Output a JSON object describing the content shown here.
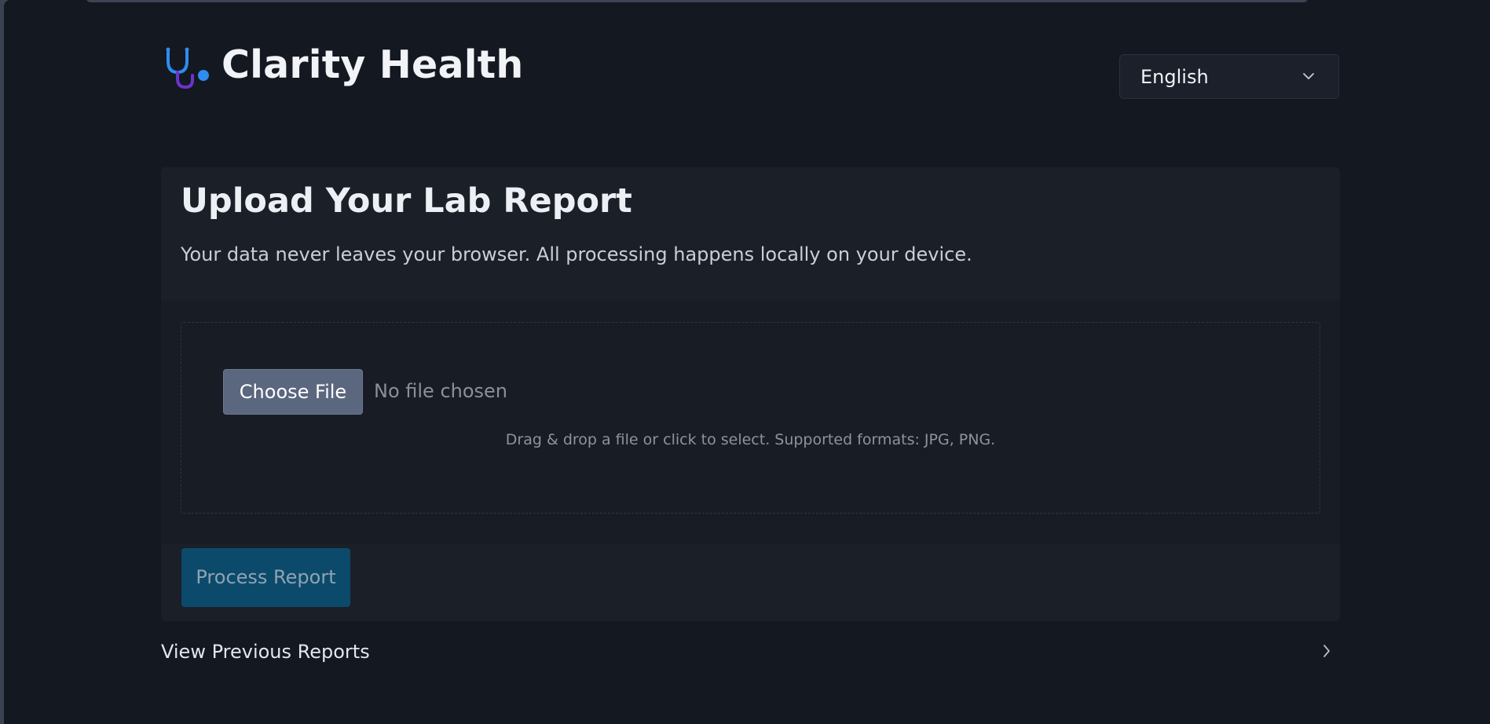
{
  "app": {
    "title": "Clarity Health",
    "logo_icon": "stethoscope-icon",
    "colors": {
      "background": "#131821",
      "card": "#1b1f28",
      "process_button": "#0c4a6b",
      "choose_button": "#5b667f",
      "logo_blue": "#2f8cf0",
      "logo_purple": "#6b34c9"
    }
  },
  "language": {
    "selected": "English",
    "icon": "chevron-down-icon"
  },
  "upload_card": {
    "title": "Upload Your Lab Report",
    "subtitle": "Your data never leaves your browser. All processing happens locally on your device.",
    "choose_file_label": "Choose File",
    "file_status": "No file chosen",
    "hint": "Drag & drop a file or click to select. Supported formats: JPG, PNG.",
    "process_label": "Process Report"
  },
  "previous_reports": {
    "label": "View Previous Reports",
    "icon": "chevron-right-icon"
  }
}
